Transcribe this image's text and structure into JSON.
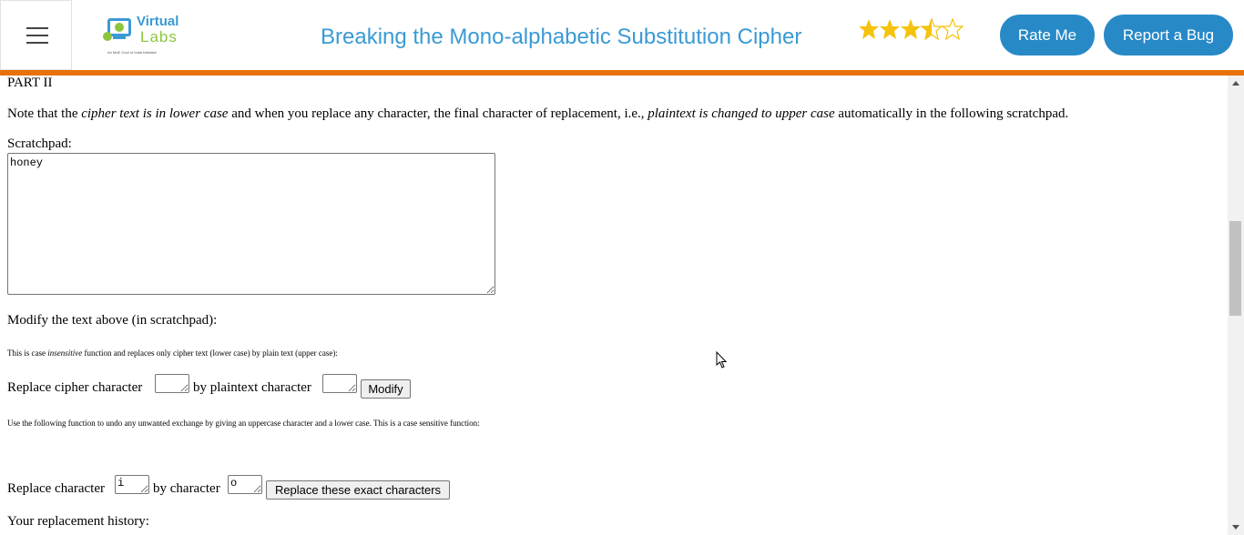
{
  "header": {
    "logo_text": "Virtual",
    "logo_sub": "Labs",
    "logo_tagline": "An MoE Govt of India Initiative",
    "title": "Breaking the Mono-alphabetic Substitution Cipher",
    "rating_value": 3.5,
    "rating_max": 5,
    "rate_label": "Rate Me",
    "bug_label": "Report a Bug",
    "accent": "#2889c7",
    "bar_color": "#e8710a"
  },
  "content": {
    "part_heading": "PART II",
    "note": {
      "t1": "Note that the ",
      "t2": "cipher text is in lower case",
      "t3": " and when you replace any character, the final character of replacement, i.e., ",
      "t4": "plaintext is changed to upper case",
      "t5": " automatically in the following scratchpad."
    },
    "scratch_label": "Scratchpad:",
    "scratch_value": "honey",
    "modify_label": "Modify the text above (in scratchpad):",
    "case_note": {
      "t1": "This is case ",
      "t2": "insensitive",
      "t3": " function and replaces only cipher text (lower case) by plain text (upper case):"
    },
    "replace1": {
      "pre": "Replace cipher character",
      "cipher_value": "",
      "mid": "by plaintext character",
      "plain_value": "",
      "button": "Modify"
    },
    "undo_note": "Use the following function to undo any unwanted exchange by giving an uppercase character and a lower case. This is a case sensitive function:",
    "replace2": {
      "pre": "Replace character",
      "from_value": "i",
      "mid": "by character",
      "to_value": "o",
      "button": "Replace these exact characters"
    },
    "history_label": "Your replacement history:"
  }
}
